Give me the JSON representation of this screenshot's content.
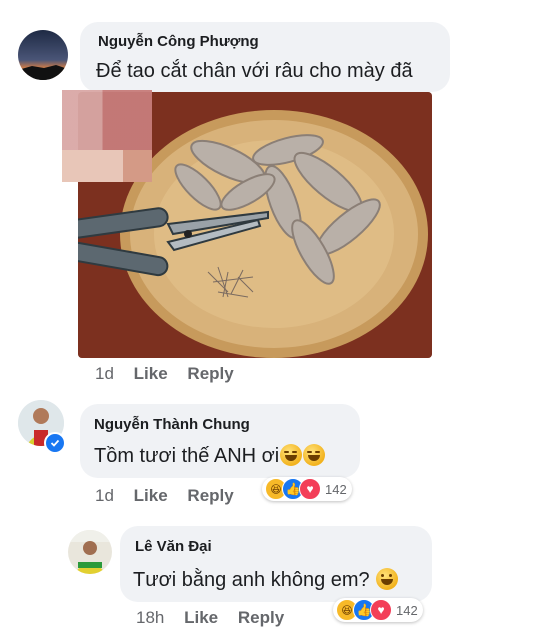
{
  "comments": [
    {
      "author": "Nguyễn Công Phượng",
      "text": "Để tao cắt chân với râu cho mày đã",
      "time": "1d",
      "like_label": "Like",
      "reply_label": "Reply",
      "attachment": "shrimp-photo"
    },
    {
      "author": "Nguyễn Thành Chung",
      "text": "Tồm tươi thế ANH ơi",
      "text_emojis": [
        "laughing-emoji",
        "laughing-emoji"
      ],
      "time": "1d",
      "like_label": "Like",
      "reply_label": "Reply",
      "verified": true,
      "reactions": {
        "types": [
          "haha",
          "like",
          "love"
        ],
        "count": "142"
      }
    },
    {
      "author": "Lê Văn Đại",
      "text": "Tươi bằng anh không em?",
      "text_emojis": [
        "smile-emoji"
      ],
      "time": "18h",
      "like_label": "Like",
      "reply_label": "Reply",
      "reactions": {
        "types": [
          "haha",
          "like",
          "love"
        ],
        "count": "142"
      }
    }
  ],
  "colors": {
    "bubble": "#f0f2f5",
    "meta_text": "#65676b",
    "like_blue": "#1877f2",
    "love_red": "#f33e58",
    "haha_yellow": "#f7b928"
  }
}
